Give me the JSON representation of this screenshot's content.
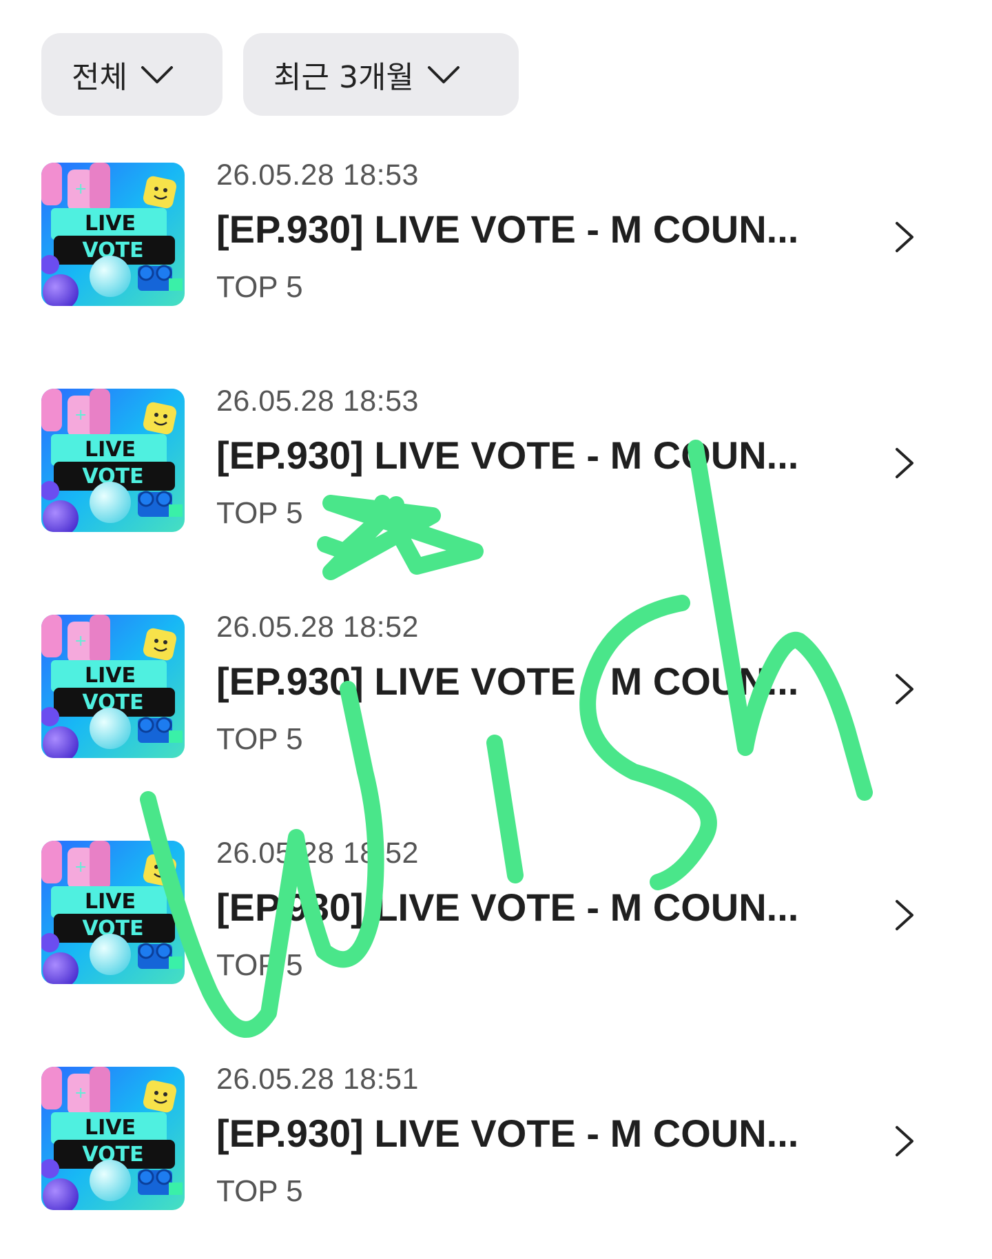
{
  "filters": {
    "category": {
      "label": "전체",
      "icon": "chevron-down-icon"
    },
    "period": {
      "label": "최근 3개월",
      "icon": "chevron-down-icon"
    }
  },
  "thumbnail": {
    "line1": "LIVE",
    "line2": "VOTE"
  },
  "items": [
    {
      "date": "26.05.28 18:53",
      "title": "[EP.930] LIVE VOTE - M COUN...",
      "subtitle": "TOP 5"
    },
    {
      "date": "26.05.28 18:53",
      "title": "[EP.930] LIVE VOTE - M COUN...",
      "subtitle": "TOP 5"
    },
    {
      "date": "26.05.28 18:52",
      "title": "[EP.930] LIVE VOTE - M COUN...",
      "subtitle": "TOP 5"
    },
    {
      "date": "26.05.28 18:52",
      "title": "[EP.930] LIVE VOTE - M COUN...",
      "subtitle": "TOP 5"
    },
    {
      "date": "26.05.28 18:51",
      "title": "[EP.930] LIVE VOTE - M COUN...",
      "subtitle": "TOP 5"
    }
  ],
  "overlay": {
    "text": "wish",
    "color": "#4ae68a",
    "has_star": true
  }
}
